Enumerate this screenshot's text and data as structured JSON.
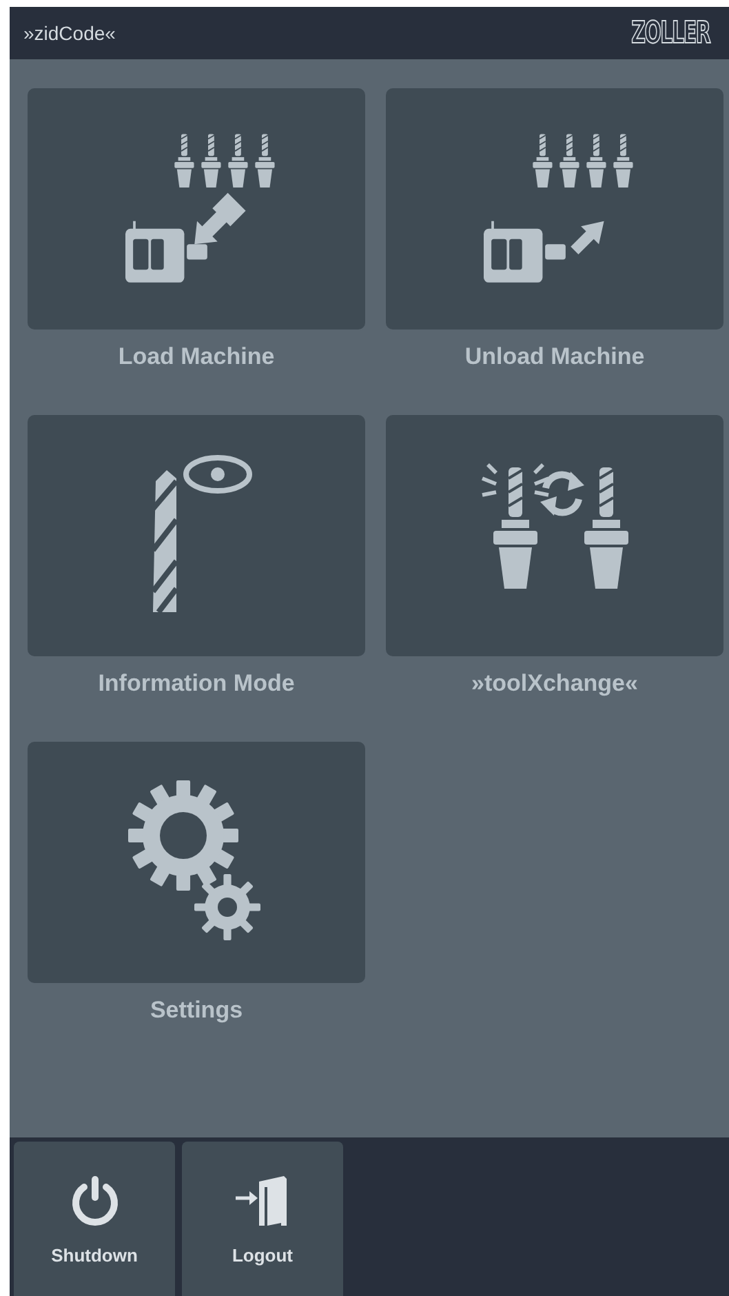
{
  "header": {
    "title": "»zidCode«",
    "logo": "ZOLLER"
  },
  "tiles": [
    {
      "kind": "load",
      "label": "Load Machine"
    },
    {
      "kind": "unload",
      "label": "Unload Machine"
    },
    {
      "kind": "info",
      "label": "Information Mode"
    },
    {
      "kind": "exchange",
      "label": "»toolXchange«"
    },
    {
      "kind": "settings",
      "label": "Settings"
    }
  ],
  "footer": [
    {
      "kind": "shutdown",
      "label": "Shutdown"
    },
    {
      "kind": "logout",
      "label": "Logout"
    }
  ]
}
